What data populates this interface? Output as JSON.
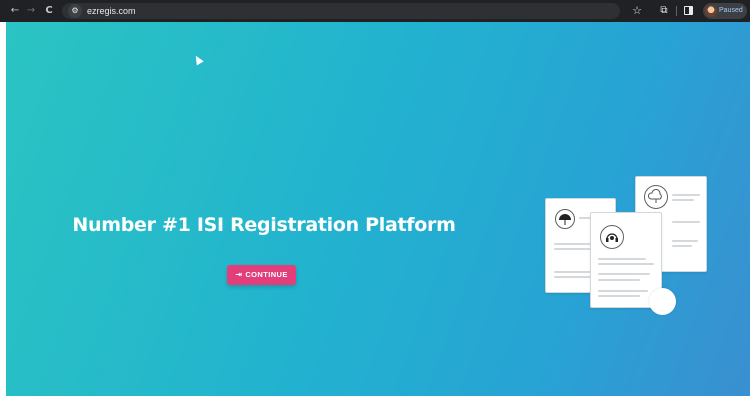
{
  "browser": {
    "nav": {
      "back_icon": "←",
      "forward_icon": "→",
      "reload_icon": "C"
    },
    "tune_icon": "⚙",
    "url": "ezregis.com",
    "star_icon": "☆",
    "extensions_icon": "⧉",
    "profile_status": "Paused"
  },
  "page": {
    "headline": "Number #1 ISI Registration Platform",
    "continue_label": "CONTINUE",
    "continue_icon": "⇥"
  },
  "colors": {
    "gradient_start": "#2bc4c2",
    "gradient_end": "#3a8fd0",
    "button": "#e23f7a"
  },
  "illustration": {
    "icons": [
      "umbrella-icon",
      "cloud-icon",
      "headset-icon"
    ]
  }
}
